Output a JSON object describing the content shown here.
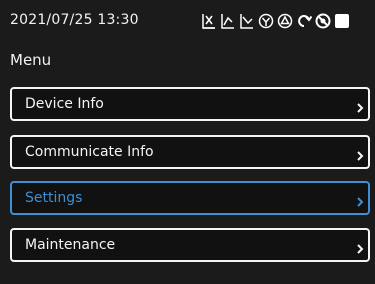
{
  "status_bar": {
    "datetime": "2021/07/25 13:30",
    "icons": [
      "chart-crossed-icon",
      "chart-up-icon",
      "chart-down-icon",
      "valve-down-icon",
      "triangle-alarm-icon",
      "refresh-icon",
      "no-entry-icon",
      "square-icon"
    ]
  },
  "page": {
    "title": "Menu"
  },
  "menu": {
    "items": [
      {
        "label": "Device Info",
        "selected": false
      },
      {
        "label": "Communicate Info",
        "selected": false
      },
      {
        "label": "Settings",
        "selected": true
      },
      {
        "label": "Maintenance",
        "selected": false
      }
    ]
  },
  "colors": {
    "background": "#1b1b1b",
    "border": "#f4f4f4",
    "selected": "#3f8fd4"
  }
}
